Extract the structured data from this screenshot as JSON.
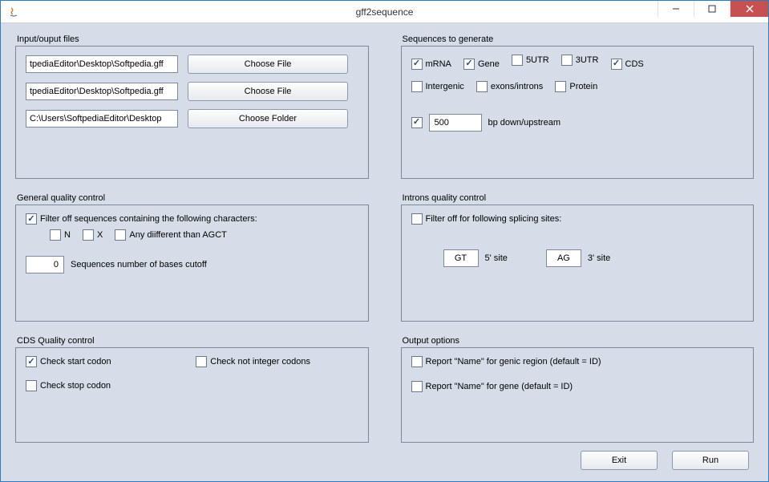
{
  "window": {
    "title": "gff2sequence"
  },
  "inputOutput": {
    "label": "Input/ouput files",
    "file1": "tpediaEditor\\Desktop\\Softpedia.gff",
    "file2": "tpediaEditor\\Desktop\\Softpedia.gff",
    "folder": "C:\\Users\\SoftpediaEditor\\Desktop",
    "chooseFileLabel": "Choose File",
    "chooseFolderLabel": "Choose Folder"
  },
  "sequences": {
    "label": "Sequences to generate",
    "mRNA": {
      "label": "mRNA",
      "checked": true
    },
    "gene": {
      "label": "Gene",
      "checked": true
    },
    "utr5": {
      "label": "5UTR",
      "checked": false
    },
    "utr3": {
      "label": "3UTR",
      "checked": false
    },
    "cds": {
      "label": "CDS",
      "checked": true
    },
    "intergenic": {
      "label": "Intergenic",
      "checked": false
    },
    "exonsIntrons": {
      "label": "exons/introns",
      "checked": false
    },
    "protein": {
      "label": "Protein",
      "checked": false
    },
    "bpCheck": {
      "checked": true
    },
    "bpValue": "500",
    "bpLabel": "bp down/upstream"
  },
  "generalQC": {
    "label": "General quality control",
    "filterLabel": "Filter off sequences containing the following characters:",
    "filterChecked": true,
    "n": {
      "label": "N",
      "checked": false
    },
    "x": {
      "label": "X",
      "checked": false
    },
    "anyDiff": {
      "label": "Any diifferent than AGCT",
      "checked": false
    },
    "cutoffValue": "0",
    "cutoffLabel": "Sequences number of bases cutoff"
  },
  "intronsQC": {
    "label": "Introns quality control",
    "filterLabel": "Filter off for following splicing sites:",
    "filterChecked": false,
    "site5Value": "GT",
    "site5Label": "5' site",
    "site3Value": "AG",
    "site3Label": "3' site"
  },
  "cdsQC": {
    "label": "CDS Quality control",
    "startCodon": {
      "label": "Check start codon",
      "checked": true
    },
    "notInteger": {
      "label": "Check not integer codons",
      "checked": false
    },
    "stopCodon": {
      "label": "Check stop codon",
      "checked": false
    }
  },
  "outputOpts": {
    "label": "Output options",
    "reportGenic": {
      "label": "Report \"Name\" for genic region (default = ID)",
      "checked": false
    },
    "reportGene": {
      "label": "Report \"Name\" for gene  (default = ID)",
      "checked": false
    }
  },
  "footer": {
    "exit": "Exit",
    "run": "Run"
  }
}
